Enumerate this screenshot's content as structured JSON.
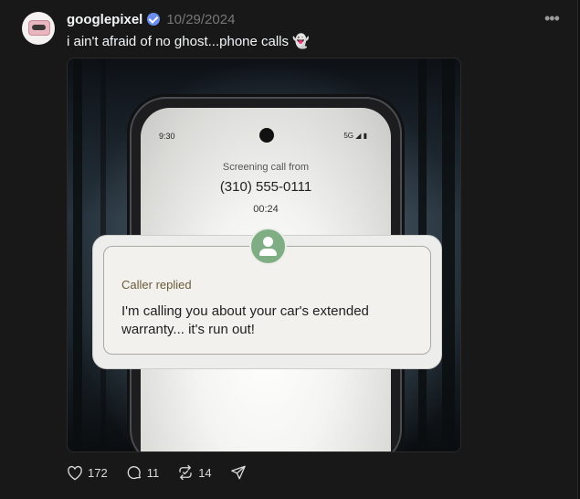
{
  "post": {
    "username": "googlepixel",
    "date": "10/29/2024",
    "caption": "i ain't afraid of no ghost...phone calls",
    "caption_emoji": "👻",
    "more_label": "•••"
  },
  "media": {
    "status_time": "9:30",
    "status_right": "5G ◢ ▮",
    "screening_label": "Screening call from",
    "phone_number": "(310) 555-0111",
    "timer": "00:24",
    "card_title": "Caller replied",
    "card_message": "I'm calling you about your car's extended warranty... it's run out!"
  },
  "actions": {
    "likes": "172",
    "comments": "11",
    "reposts": "14"
  },
  "colors": {
    "background": "#181818",
    "verified": "#6b8cf0",
    "caller_icon": "#7fae84"
  }
}
